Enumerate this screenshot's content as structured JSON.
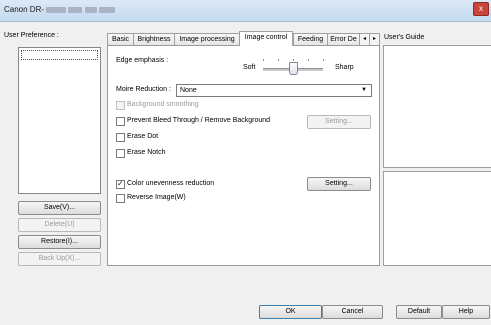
{
  "window": {
    "title_prefix": "Canon DR-",
    "close_glyph": "x"
  },
  "left": {
    "user_preference_label": "User Preference :",
    "buttons": {
      "save": "Save(V)...",
      "delete": "Delete(U)",
      "restore": "Restore(I)...",
      "backup": "Back Up(X)..."
    }
  },
  "tabs": [
    "Basic",
    "Brightness",
    "Image processing",
    "Image control",
    "Feeding",
    "Error De"
  ],
  "tab_scroll": {
    "left": "◂",
    "right": "▸"
  },
  "image_control": {
    "edge_emphasis_label": "Edge emphasis :",
    "soft_label": "Soft",
    "sharp_label": "Sharp",
    "edge_level": 0.5,
    "moire_label": "Moire Reduction :",
    "moire_value": "None",
    "background_smoothing": "Background smoothing",
    "prevent_bleed": "Prevent Bleed Through / Remove Background",
    "setting_disabled": "Setting...",
    "erase_dot": "Erase Dot",
    "erase_notch": "Erase Notch",
    "color_unevenness": "Color unevenness reduction",
    "setting_enabled": "Setting...",
    "reverse_image": "Reverse Image(W)"
  },
  "users_guide_label": "User's Guide",
  "footer": {
    "ok": "OK",
    "cancel": "Cancel",
    "default": "Default",
    "help": "Help"
  }
}
